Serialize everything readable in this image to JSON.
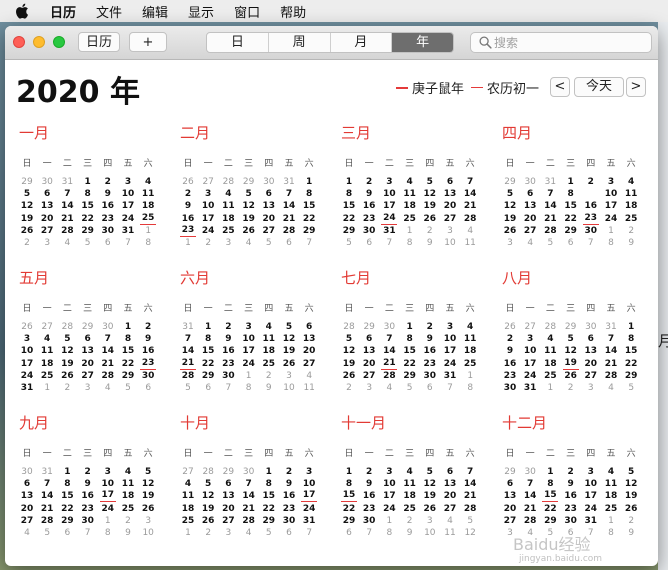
{
  "menubar": {
    "app": "日历",
    "items": [
      "文件",
      "编辑",
      "显示",
      "窗口",
      "帮助"
    ]
  },
  "toolbar": {
    "calendars_label": "日历",
    "add_label": "+",
    "views": [
      "日",
      "周",
      "月",
      "年"
    ],
    "active_view": "年",
    "search_placeholder": "搜索"
  },
  "header": {
    "year_title": "2020 年",
    "legend_lunar_year": "庚子鼠年",
    "legend_lunar_day": "农历初一",
    "prev_label": "<",
    "today_label": "今天",
    "next_label": ">"
  },
  "weekdays": [
    "日",
    "一",
    "二",
    "三",
    "四",
    "五",
    "六"
  ],
  "months": [
    {
      "name": "一月",
      "lead": [
        29,
        30,
        31
      ],
      "days": 31,
      "hl": [
        25
      ]
    },
    {
      "name": "二月",
      "lead": [
        26,
        27,
        28,
        29,
        30,
        31
      ],
      "days": 29,
      "hl": [
        23
      ]
    },
    {
      "name": "三月",
      "lead": [],
      "days": 31,
      "hl": [
        24
      ]
    },
    {
      "name": "四月",
      "lead": [
        29,
        30,
        31
      ],
      "days": 30,
      "hl": [
        23
      ],
      "today": 9
    },
    {
      "name": "五月",
      "lead": [
        26,
        27,
        28,
        29,
        30
      ],
      "days": 31,
      "hl": [
        23
      ]
    },
    {
      "name": "六月",
      "lead": [
        31
      ],
      "days": 30,
      "hl": [
        21
      ]
    },
    {
      "name": "七月",
      "lead": [
        28,
        29,
        30
      ],
      "days": 31,
      "hl": [
        21
      ]
    },
    {
      "name": "八月",
      "lead": [
        26,
        27,
        28,
        29,
        30,
        31
      ],
      "days": 31,
      "hl": [
        19
      ]
    },
    {
      "name": "九月",
      "lead": [
        30,
        31
      ],
      "days": 30,
      "hl": [
        17
      ]
    },
    {
      "name": "十月",
      "lead": [
        27,
        28,
        29,
        30
      ],
      "days": 31,
      "hl": [
        17
      ]
    },
    {
      "name": "十一月",
      "lead": [],
      "days": 30,
      "hl": [
        15
      ]
    },
    {
      "name": "十二月",
      "lead": [
        29,
        30
      ],
      "days": 31,
      "hl": [
        15
      ]
    }
  ],
  "watermark": {
    "main": "Baidu经验",
    "sub": "jingyan.baidu.com"
  },
  "colors": {
    "accent": "#e23a34",
    "active_segment": "#6e6e6e"
  }
}
